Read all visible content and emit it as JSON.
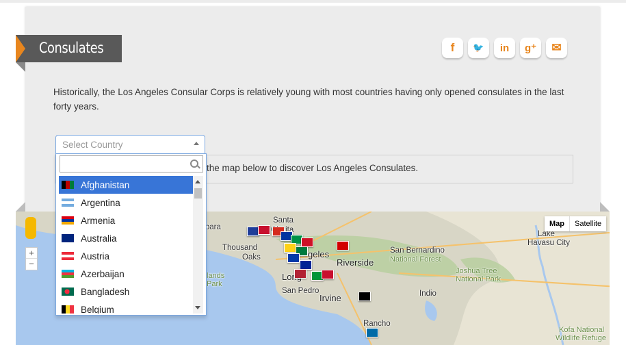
{
  "header": {
    "title": "Consulates"
  },
  "social": [
    {
      "name": "facebook-icon",
      "glyph": "f"
    },
    {
      "name": "twitter-icon",
      "glyph": "🐦"
    },
    {
      "name": "linkedin-icon",
      "glyph": "in"
    },
    {
      "name": "googleplus-icon",
      "glyph": "g⁺"
    },
    {
      "name": "email-icon",
      "glyph": "✉"
    }
  ],
  "intro": "Historically, the Los Angeles Consular Corps is relatively young with most countries having only opened consulates in the last forty years.",
  "hint": "the map below to discover Los Angeles Consulates.",
  "select": {
    "placeholder": "Select Country",
    "options": [
      {
        "label": "Afghanistan",
        "selected": true
      },
      {
        "label": "Argentina"
      },
      {
        "label": "Armenia"
      },
      {
        "label": "Australia"
      },
      {
        "label": "Austria"
      },
      {
        "label": "Azerbaijan"
      },
      {
        "label": "Bangladesh"
      },
      {
        "label": "Belgium"
      }
    ]
  },
  "map": {
    "type_buttons": {
      "map": "Map",
      "satellite": "Satellite"
    },
    "zoom": {
      "plus": "+",
      "minus": "−"
    },
    "labels": {
      "barbara": "rbara",
      "santa": "Santa",
      "clarita": "Clarita",
      "thousand": "Thousand",
      "oaks": "Oaks",
      "geles": "geles",
      "riverside": "Riverside",
      "san_bernardino": "San Bernardino",
      "national_forest": "National Forest",
      "joshua_tree": "Joshua Tree",
      "joshua_park": "National Park",
      "lake": "Lake",
      "havasu": "Havasu City",
      "lands": "lands",
      "park": "Park",
      "long": "Long",
      "san_pedro": "San Pedro",
      "irvine": "Irvine",
      "indio": "Indio",
      "rancho": "Rancho",
      "kofa": "Kofa National",
      "wildlife": "Wildlife Refuge"
    },
    "colors": {
      "water": "#a8c8ee",
      "land": "#d8d6c6",
      "desert": "#e8e4d4",
      "green": "#b6ce9c"
    }
  }
}
